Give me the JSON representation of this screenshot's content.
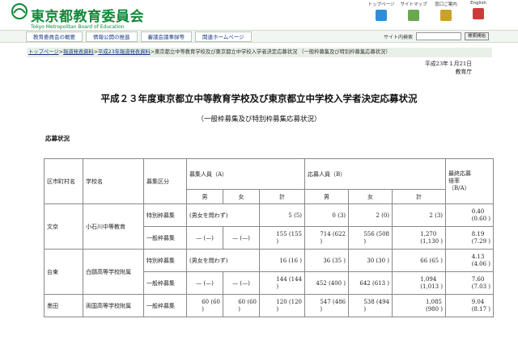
{
  "header": {
    "logo_title": "東京都教育委員会",
    "logo_sub": "Tokyo Metropolitan Board of Education",
    "top_links": [
      {
        "label": "トップページ",
        "icon": "home-icon",
        "color": "#2f8fd6"
      },
      {
        "label": "サイトマップ",
        "icon": "sitemap-icon",
        "color": "#6aa84f"
      },
      {
        "label": "窓口ご案内",
        "icon": "info-desk-icon",
        "color": "#c9a227"
      },
      {
        "label": "English",
        "icon": "english-icon",
        "color": "#cc3b3b"
      }
    ]
  },
  "nav": {
    "tabs": [
      "教育委員会の概要",
      "情報公開の推進",
      "審議会議事録等",
      "関連ホームページ"
    ],
    "search_label": "サイト内検索",
    "search_button": "検索開始"
  },
  "breadcrumb": {
    "items": [
      "トップページ",
      "報道発表資料",
      "平成23年報道発表資料"
    ],
    "current": "東京都立中等教育学校及び東京都立中学校入学者決定応募状況 （一般枠募集及び特別枠募集応募状況）"
  },
  "date": {
    "line1": "平成23年１月21日",
    "line2": "教育庁"
  },
  "title": "平成２３年度東京都立中等教育学校及び東京都立中学校入学者決定応募状況",
  "subtitle": "（一般枠募集及び特別枠募集応募状況）",
  "section_heading": "応募状況",
  "table": {
    "headers": {
      "ward": "区市町村名",
      "school": "学校名",
      "category": "募集区分",
      "capacity": "募集人員（A）",
      "applicants": "応募人員（B）",
      "ratio": "最終応募\n倍率\n（B/A）",
      "male": "男",
      "female": "女",
      "total": "計"
    },
    "rows": [
      {
        "ward": "文京",
        "school": "小石川中等教育",
        "category": "特別枠募集",
        "cap_note": "(男女を問わず)",
        "cap_total": "5 (5)",
        "app_male": "0 (3)",
        "app_female": "2 (0)",
        "app_total": "2 (3)",
        "ratio": "0.40\n(0.60 )"
      },
      {
        "ward": "",
        "school": "",
        "category": "一般枠募集",
        "cap_male": "— (—)",
        "cap_female": "— (—)",
        "cap_total": "155 (155\n)",
        "app_male": "714 (622\n)",
        "app_female": "556 (508\n)",
        "app_total": "1,270\n(1,130 )",
        "ratio": "8.19\n(7.29 )"
      },
      {
        "ward": "台東",
        "school": "白鷗高等学校附属",
        "category": "特別枠募集",
        "cap_note": "(男女を問わず)",
        "cap_total": "16 (16 )",
        "app_male": "36 (35 )",
        "app_female": "30 (30 )",
        "app_total": "66 (65 )",
        "ratio": "4.13\n(4.06 )"
      },
      {
        "ward": "",
        "school": "",
        "category": "一般枠募集",
        "cap_male": "— (—)",
        "cap_female": "— (—)",
        "cap_total": "144 (144\n)",
        "app_male": "452 (400 )",
        "app_female": "642 (613 )",
        "app_total": "1,094\n(1,013 )",
        "ratio": "7.60\n(7.03 )"
      },
      {
        "ward": "墨田",
        "school": "両国高等学校附属",
        "category": "一般枠募集",
        "cap_male": "60 (60\n)",
        "cap_female": "60 (60\n)",
        "cap_total": "120 (120\n)",
        "app_male": "547 (486\n)",
        "app_female": "538 (494\n)",
        "app_total": "1,085\n(980 )",
        "ratio": "9.04\n(8.17 )"
      }
    ]
  }
}
